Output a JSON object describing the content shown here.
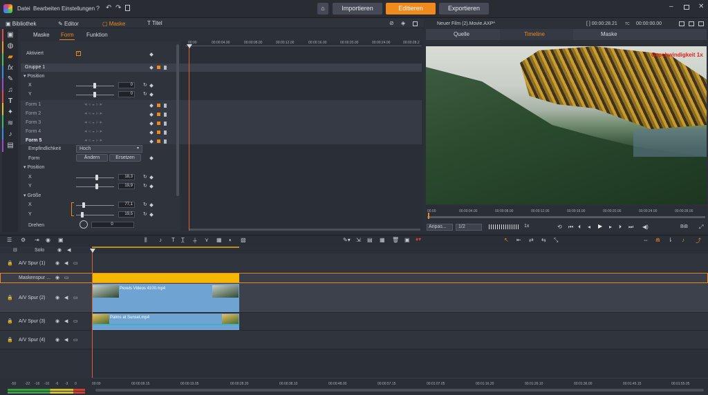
{
  "menu": {
    "file": "Datei",
    "edit": "Bearbeiten",
    "settings": "Einstellungen"
  },
  "nav": {
    "import": "Importieren",
    "edit": "Editieren",
    "export": "Exportieren"
  },
  "left_tabs": {
    "library": "Bibliothek",
    "editor": "Editor",
    "mask": "Maske",
    "title": "Titel"
  },
  "sub_tabs": {
    "mask": "Maske",
    "shape": "Form",
    "function": "Funktion"
  },
  "props": {
    "activated": "Aktiviert",
    "group1": "Gruppe 1",
    "position": "Position",
    "x": "X",
    "y": "Y",
    "pos_x": "0",
    "pos_y": "0",
    "forms": [
      "Form 1",
      "Form 2",
      "Form 3",
      "Form 4",
      "Form 5"
    ],
    "sensitivity": "Empfindlichkeit",
    "sensitivity_value": "Hoch",
    "form_label": "Form",
    "change": "Ändern",
    "replace": "Ersetzen",
    "position2": "Position",
    "pos2_x": "18,3",
    "pos2_y": "19,9",
    "size": "Größe",
    "size_x": "77,1",
    "size_y": "19,5",
    "rotate": "Drehen",
    "rotate_value": "0"
  },
  "ruler_top": [
    "00:00",
    "00:00:04.00",
    "00:00:08.00",
    "00:00:12.00",
    "00:00:16.00",
    "00:00:20.00",
    "00:00:24.00",
    "00:00:28.2"
  ],
  "preview": {
    "title": "Neuer Film (2).Movie.AXP*",
    "timecode": "[ ] 00:00:28.21",
    "tc_label": "TC",
    "tc_value": "00:00:00.00",
    "tabs": {
      "source": "Quelle",
      "timeline": "Timeline",
      "mask": "Maske"
    },
    "overlay_text": "Geschwindigkeit 1x",
    "ruler": [
      "00.00",
      "00:00:04.00",
      "00:00:08.00",
      "00:00:12.00",
      "00:00:16.00",
      "00:00:20.00",
      "00:00:24.00",
      "00:00:28.00"
    ],
    "fit": "Anpas...",
    "ratio": "1/2",
    "speed": "1x",
    "bib": "BiB"
  },
  "tracks": {
    "solo": "Solo",
    "rows": [
      "A/V Spur (1)",
      "Maskenspur ...",
      "A/V Spur (2)",
      "A/V Spur (3)",
      "A/V Spur (4)"
    ],
    "clip1": "Pexels Videos 4100.mp4",
    "clip2": "Palms at Sunset.mp4"
  },
  "bottom_ruler": [
    "00:00",
    "00:00:09.15",
    "00:00:19.05",
    "00:00:28.20",
    "00:00:38.10",
    "00:00:48.00",
    "00:00:57.15",
    "00:01:07.05",
    "00:01:16.20",
    "00:01:26.10",
    "00:01:36.00",
    "00:01:45.15",
    "00:01:55.05"
  ],
  "meter": [
    "-50",
    "-22",
    "-16",
    "-10",
    "-6",
    "-3",
    "0"
  ],
  "colors": {
    "accent": "#f08a1c",
    "clip_blue": "#6fa4d2",
    "mask_yellow": "#f5b800"
  }
}
